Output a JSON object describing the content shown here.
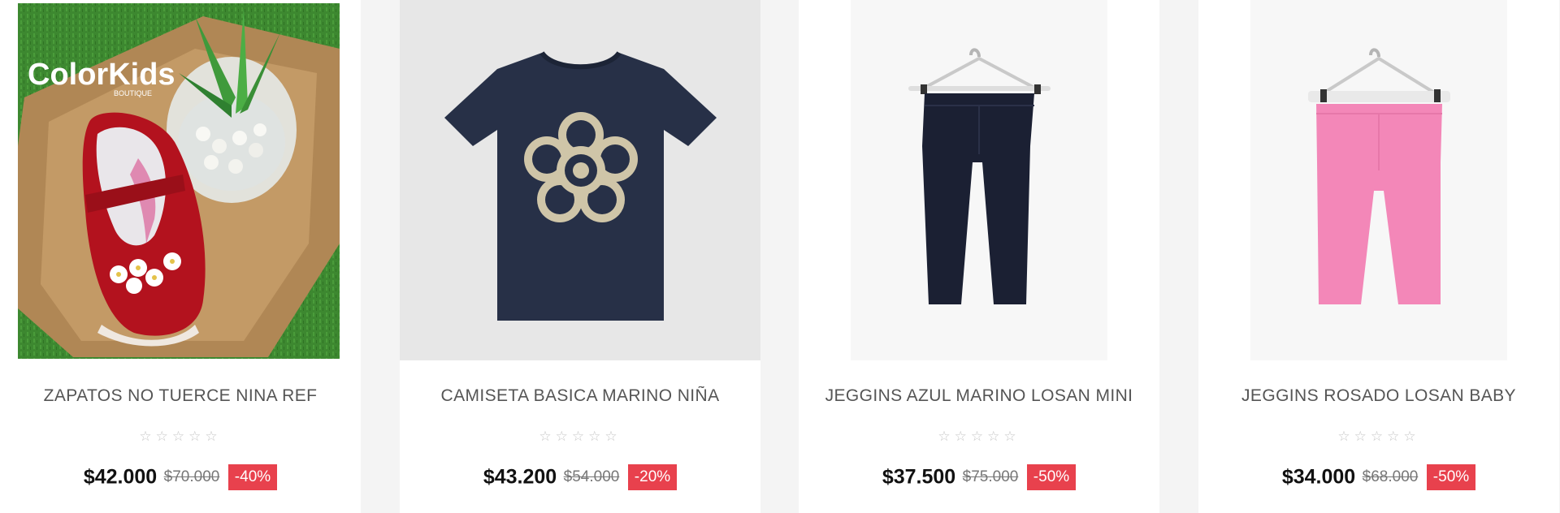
{
  "products": [
    {
      "name": "ZAPATOS NO TUERCE NINA REF",
      "price": "$42.000",
      "old_price": "$70.000",
      "discount": "-40%",
      "rating": 0,
      "image_brand": "ColorKids",
      "image_brand_sub": "BOUTIQUE"
    },
    {
      "name": "CAMISETA BASICA MARINO NIÑA",
      "price": "$43.200",
      "old_price": "$54.000",
      "discount": "-20%",
      "rating": 0
    },
    {
      "name": "JEGGINS AZUL MARINO LOSAN MINI",
      "price": "$37.500",
      "old_price": "$75.000",
      "discount": "-50%",
      "rating": 0
    },
    {
      "name": "JEGGINS ROSADO LOSAN BABY",
      "price": "$34.000",
      "old_price": "$68.000",
      "discount": "-50%",
      "rating": 0
    }
  ],
  "colors": {
    "badge": "#e8414d",
    "price": "#111111",
    "title": "#555555",
    "star_empty": "#c8c8c8"
  },
  "icons": {
    "star": "star-outline-icon"
  }
}
